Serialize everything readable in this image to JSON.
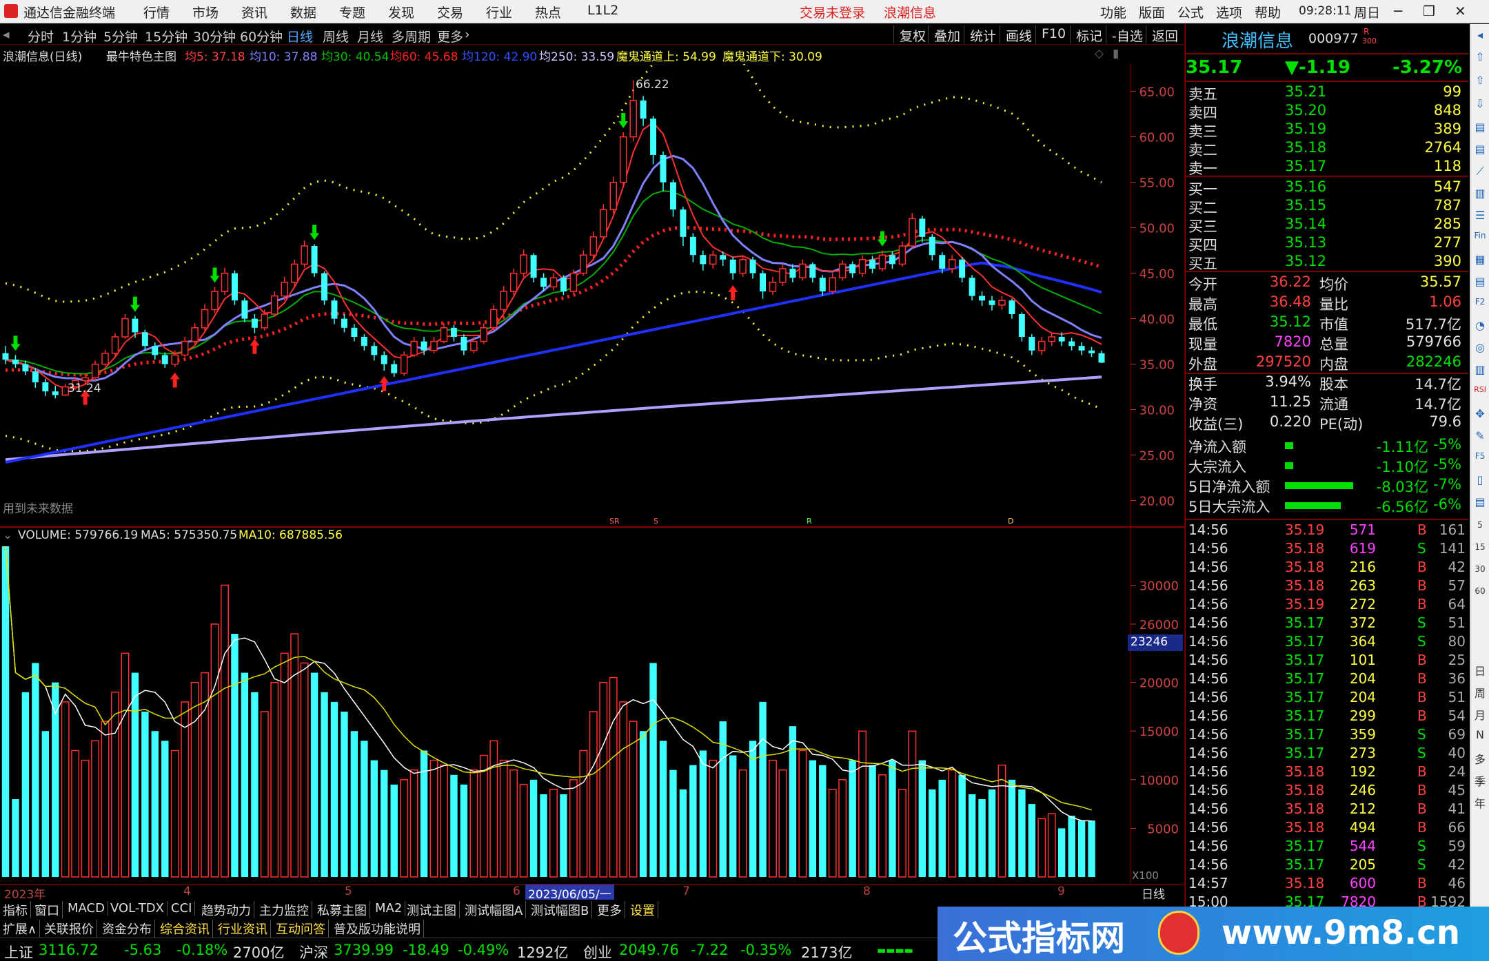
{
  "app": {
    "title": "通达信金融终端",
    "menu": [
      "行情",
      "市场",
      "资讯",
      "数据",
      "专题",
      "发现",
      "交易",
      "行业",
      "热点",
      "L1L2"
    ],
    "login_status": "交易未登录",
    "stock_title": "浪潮信息",
    "right_menu": [
      "功能",
      "版面",
      "公式",
      "选项",
      "帮助"
    ],
    "clock": "09:28:11",
    "weekday": "周日"
  },
  "periods": [
    "分时",
    "1分钟",
    "5分钟",
    "15分钟",
    "30分钟",
    "60分钟",
    "日线",
    "周线",
    "月线",
    "多周期",
    "更多"
  ],
  "active_period": "日线",
  "tools": [
    "复权",
    "叠加",
    "统计",
    "画线",
    "F10",
    "标记",
    "-自选",
    "返回"
  ],
  "legend": {
    "name": "浪潮信息(日线)",
    "formula": "最牛特色主图",
    "ma5": "均5: 37.18",
    "ma10": "均10: 37.88",
    "ma30": "均30: 40.54",
    "ma60": "均60: 45.68",
    "ma120": "均120: 42.90",
    "ma250": "均250: 33.59",
    "up": "魔鬼通道上: 54.99",
    "down": "魔鬼通道下: 30.09"
  },
  "price_axis": [
    "65.00",
    "60.00",
    "55.00",
    "50.00",
    "45.00",
    "40.00",
    "35.00",
    "30.00",
    "25.00",
    "20.00"
  ],
  "annotations": {
    "high": "66.22",
    "low": "31.24",
    "future": "用到未来数据"
  },
  "markers": [
    "SR",
    "S",
    "R",
    "D"
  ],
  "volume_legend": {
    "vol": "VOLUME: 579766.19",
    "ma5": "MA5: 575350.75",
    "ma10": "MA10: 687885.56"
  },
  "vol_axis": [
    "30000",
    "26000",
    "20000",
    "15000",
    "10000",
    "5000"
  ],
  "vol_cursor": "23246",
  "vol_unit": "X100",
  "date_axis": [
    "2023年",
    "4",
    "5",
    "6",
    "2023/06/05/一",
    "7",
    "8",
    "9"
  ],
  "date_axis_right": "日线",
  "stock": {
    "name": "浪潮信息",
    "code": "000977",
    "tag": "R",
    "tag2": "300",
    "price": "35.17",
    "change": "▼-1.19",
    "pct": "-3.27%"
  },
  "asks": [
    {
      "label": "卖五",
      "price": "35.21",
      "vol": "99"
    },
    {
      "label": "卖四",
      "price": "35.20",
      "vol": "848"
    },
    {
      "label": "卖三",
      "price": "35.19",
      "vol": "389"
    },
    {
      "label": "卖二",
      "price": "35.18",
      "vol": "2764"
    },
    {
      "label": "卖一",
      "price": "35.17",
      "vol": "118"
    }
  ],
  "bids": [
    {
      "label": "买一",
      "price": "35.16",
      "vol": "547"
    },
    {
      "label": "买二",
      "price": "35.15",
      "vol": "787"
    },
    {
      "label": "买三",
      "price": "35.14",
      "vol": "285"
    },
    {
      "label": "买四",
      "price": "35.13",
      "vol": "277"
    },
    {
      "label": "买五",
      "price": "35.12",
      "vol": "390"
    }
  ],
  "stats": [
    {
      "l1": "今开",
      "v1": "36.22",
      "l2": "均价",
      "v2": "35.57",
      "c1": "#ff4040",
      "c2": "#ffff40"
    },
    {
      "l1": "最高",
      "v1": "36.48",
      "l2": "量比",
      "v2": "1.06",
      "c1": "#ff4040",
      "c2": "#ff4040"
    },
    {
      "l1": "最低",
      "v1": "35.12",
      "l2": "市值",
      "v2": "517.7亿",
      "c1": "#00e000",
      "c2": "#e0e0e0"
    },
    {
      "l1": "现量",
      "v1": "7820",
      "l2": "总量",
      "v2": "579766",
      "c1": "#ff40ff",
      "c2": "#e0e0e0"
    },
    {
      "l1": "外盘",
      "v1": "297520",
      "l2": "内盘",
      "v2": "282246",
      "c1": "#ff4040",
      "c2": "#00e000"
    },
    {
      "l1": "换手",
      "v1": "3.94%",
      "l2": "股本",
      "v2": "14.7亿",
      "c1": "#e0e0e0",
      "c2": "#e0e0e0"
    },
    {
      "l1": "净资",
      "v1": "11.25",
      "l2": "流通",
      "v2": "14.7亿",
      "c1": "#e0e0e0",
      "c2": "#e0e0e0"
    },
    {
      "l1": "收益(三)",
      "v1": "0.220",
      "l2": "PE(动)",
      "v2": "79.6",
      "c1": "#e0e0e0",
      "c2": "#e0e0e0"
    }
  ],
  "flows": [
    {
      "label": "净流入额",
      "val": "-1.11亿",
      "pct": "-5%",
      "bar": 0.12
    },
    {
      "label": "大宗流入",
      "val": "-1.10亿",
      "pct": "-5%",
      "bar": 0.12
    },
    {
      "label": "5日净流入额",
      "val": "-8.03亿",
      "pct": "-7%",
      "bar": 0.95
    },
    {
      "label": "5日大宗流入",
      "val": "-6.56亿",
      "pct": "-6%",
      "bar": 0.78
    }
  ],
  "ticks": [
    {
      "t": "14:56",
      "p": "35.19",
      "v": "571",
      "s": "B",
      "n": "161"
    },
    {
      "t": "14:56",
      "p": "35.18",
      "v": "619",
      "s": "S",
      "n": "141"
    },
    {
      "t": "14:56",
      "p": "35.18",
      "v": "216",
      "s": "B",
      "n": "42"
    },
    {
      "t": "14:56",
      "p": "35.18",
      "v": "263",
      "s": "B",
      "n": "57"
    },
    {
      "t": "14:56",
      "p": "35.19",
      "v": "272",
      "s": "B",
      "n": "64"
    },
    {
      "t": "14:56",
      "p": "35.17",
      "v": "372",
      "s": "S",
      "n": "51"
    },
    {
      "t": "14:56",
      "p": "35.17",
      "v": "364",
      "s": "S",
      "n": "80"
    },
    {
      "t": "14:56",
      "p": "35.17",
      "v": "101",
      "s": "B",
      "n": "25"
    },
    {
      "t": "14:56",
      "p": "35.17",
      "v": "204",
      "s": "B",
      "n": "36"
    },
    {
      "t": "14:56",
      "p": "35.17",
      "v": "204",
      "s": "B",
      "n": "51"
    },
    {
      "t": "14:56",
      "p": "35.17",
      "v": "299",
      "s": "B",
      "n": "54"
    },
    {
      "t": "14:56",
      "p": "35.17",
      "v": "359",
      "s": "S",
      "n": "69"
    },
    {
      "t": "14:56",
      "p": "35.17",
      "v": "273",
      "s": "S",
      "n": "40"
    },
    {
      "t": "14:56",
      "p": "35.18",
      "v": "192",
      "s": "B",
      "n": "24"
    },
    {
      "t": "14:56",
      "p": "35.18",
      "v": "246",
      "s": "B",
      "n": "45"
    },
    {
      "t": "14:56",
      "p": "35.18",
      "v": "212",
      "s": "B",
      "n": "41"
    },
    {
      "t": "14:56",
      "p": "35.18",
      "v": "494",
      "s": "B",
      "n": "66"
    },
    {
      "t": "14:56",
      "p": "35.17",
      "v": "544",
      "s": "S",
      "n": "59"
    },
    {
      "t": "14:56",
      "p": "35.17",
      "v": "205",
      "s": "S",
      "n": "42"
    },
    {
      "t": "14:57",
      "p": "35.18",
      "v": "600",
      "s": "B",
      "n": "46"
    },
    {
      "t": "15:00",
      "p": "35.17",
      "v": "7820",
      "s": "B",
      "n": "1592"
    }
  ],
  "bottom_tabs": [
    "指标",
    "窗口",
    "MACD",
    "VOL-TDX",
    "CCI",
    "趋势动力",
    "主力监控",
    "私募主图",
    "MA2",
    "测试主图",
    "测试幅图A",
    "测试幅图B",
    "更多",
    "设置"
  ],
  "bottom_tabs2": [
    "扩展∧",
    "关联报价",
    "资金分布",
    "综合资讯",
    "行业资讯",
    "互动问答",
    "普及版功能说明"
  ],
  "status": {
    "sh_name": "上证",
    "sh_val": "3116.72",
    "sh_chg": "-5.63",
    "sh_pct": "-0.18%",
    "sh_amt": "2700亿",
    "hs_name": "沪深",
    "hs_val": "3739.99",
    "hs_chg": "-18.49",
    "hs_pct": "-0.49%",
    "hs_amt": "1292亿",
    "cy_name": "创业",
    "cy_val": "2049.76",
    "cy_chg": "-7.22",
    "cy_pct": "-0.35%",
    "cy_amt": "2173亿"
  },
  "banner": {
    "text": "公式指标网",
    "url": "www.9m8.cn"
  },
  "sidebar_labels": [
    "日",
    "周",
    "月",
    "N",
    "多",
    "季",
    "年",
    "5",
    "15",
    "30",
    "60"
  ],
  "chart_data": {
    "type": "candlestick",
    "ylim": [
      18,
      68
    ],
    "candles": [
      [
        36.2,
        35.5,
        37,
        35
      ],
      [
        35.5,
        35,
        36,
        34.6
      ],
      [
        35,
        34.2,
        35.4,
        33.8
      ],
      [
        34.2,
        33,
        34.6,
        32.4
      ],
      [
        33,
        32,
        33.4,
        31.5
      ],
      [
        32,
        31.6,
        32.6,
        31.24
      ],
      [
        31.6,
        32.5,
        32.8,
        31.5
      ],
      [
        32.5,
        33.2,
        33.6,
        32.2
      ],
      [
        33.2,
        33.5,
        34,
        32.8
      ],
      [
        33.5,
        35,
        35.4,
        33.2
      ],
      [
        35,
        36.2,
        36.6,
        34.8
      ],
      [
        36.2,
        38,
        38.4,
        35.9
      ],
      [
        38,
        40,
        40.5,
        37.8
      ],
      [
        40,
        38.5,
        40.3,
        37.9
      ],
      [
        38.5,
        37,
        38.8,
        36.5
      ],
      [
        37,
        36,
        37.4,
        35.5
      ],
      [
        36,
        35,
        36.3,
        34.6
      ],
      [
        35,
        36,
        36.5,
        34.7
      ],
      [
        36,
        37.5,
        38,
        35.8
      ],
      [
        37.5,
        39,
        39.5,
        37.2
      ],
      [
        39,
        41,
        41.6,
        38.7
      ],
      [
        41,
        43,
        43.5,
        40.6
      ],
      [
        43,
        45,
        45.6,
        42.6
      ],
      [
        45,
        42,
        45.3,
        41.5
      ],
      [
        42,
        40,
        42.3,
        39.6
      ],
      [
        40,
        39,
        40.5,
        38.4
      ],
      [
        39,
        40.5,
        41,
        38.7
      ],
      [
        40.5,
        42.5,
        43,
        40.2
      ],
      [
        42.5,
        44,
        44.6,
        42
      ],
      [
        44,
        46,
        46.5,
        43.6
      ],
      [
        46,
        48,
        48.6,
        45.6
      ],
      [
        48,
        45,
        48.2,
        44.6
      ],
      [
        45,
        42,
        45.2,
        41.5
      ],
      [
        42,
        40,
        42.3,
        39.4
      ],
      [
        40,
        39,
        40.5,
        38.5
      ],
      [
        39,
        38,
        39.4,
        37.5
      ],
      [
        38,
        37,
        38.3,
        36.5
      ],
      [
        37,
        36,
        37.4,
        35.4
      ],
      [
        36,
        35,
        36.4,
        34.3
      ],
      [
        35,
        34,
        35.4,
        33.6
      ],
      [
        34,
        36,
        36.4,
        33.7
      ],
      [
        36,
        37.5,
        38,
        35.8
      ],
      [
        37.5,
        36.5,
        38,
        36
      ],
      [
        36.5,
        37.5,
        38,
        36.2
      ],
      [
        37.5,
        39,
        39.5,
        37.3
      ],
      [
        39,
        38,
        39.3,
        37.5
      ],
      [
        38,
        36.5,
        38.3,
        36
      ],
      [
        36.5,
        37.5,
        38,
        36.2
      ],
      [
        37.5,
        39,
        39.5,
        37.2
      ],
      [
        39,
        41,
        41.5,
        38.7
      ],
      [
        41,
        43,
        43.6,
        40.7
      ],
      [
        43,
        45,
        45.5,
        42.6
      ],
      [
        45,
        47,
        47.6,
        44.6
      ],
      [
        47,
        44.5,
        47.2,
        44
      ],
      [
        44.5,
        43.5,
        45,
        43
      ],
      [
        43.5,
        44.5,
        45,
        43.1
      ],
      [
        44.5,
        43,
        44.8,
        42.6
      ],
      [
        43,
        45,
        45.4,
        42.8
      ],
      [
        45,
        47,
        47.5,
        44.7
      ],
      [
        47,
        49,
        49.6,
        46.6
      ],
      [
        49,
        52,
        52.6,
        48.7
      ],
      [
        52,
        55,
        55.6,
        51.6
      ],
      [
        55,
        60,
        60.5,
        54.6
      ],
      [
        60,
        64,
        66.22,
        59.5
      ],
      [
        64,
        62,
        64.5,
        61.2
      ],
      [
        62,
        58,
        62.3,
        57
      ],
      [
        58,
        55,
        58.4,
        54
      ],
      [
        55,
        52,
        55.3,
        51.2
      ],
      [
        52,
        49,
        52.3,
        48
      ],
      [
        49,
        47,
        49.4,
        46.2
      ],
      [
        47,
        46,
        47.5,
        45.3
      ],
      [
        46,
        47,
        47.5,
        45.5
      ],
      [
        47,
        46.5,
        47.4,
        45.8
      ],
      [
        46.5,
        45,
        46.8,
        44.3
      ],
      [
        45,
        46.5,
        47,
        44.6
      ],
      [
        46.5,
        45,
        46.8,
        44.4
      ],
      [
        45,
        43,
        45.3,
        42.2
      ],
      [
        43,
        44,
        44.6,
        42.6
      ],
      [
        44,
        45.5,
        46,
        43.6
      ],
      [
        45.5,
        44.5,
        46,
        44
      ],
      [
        44.5,
        46,
        46.5,
        44.2
      ],
      [
        46,
        44.5,
        46.2,
        44
      ],
      [
        44.5,
        43,
        44.8,
        42.5
      ],
      [
        43,
        44.5,
        45,
        42.7
      ],
      [
        44.5,
        46,
        46.4,
        44.2
      ],
      [
        46,
        45,
        46.3,
        44.5
      ],
      [
        45,
        46.5,
        47,
        44.6
      ],
      [
        46.5,
        45.5,
        46.9,
        45
      ],
      [
        45.5,
        47,
        47.5,
        45.2
      ],
      [
        47,
        46,
        47.4,
        45.5
      ],
      [
        46,
        48,
        48.5,
        45.7
      ],
      [
        48,
        51,
        51.6,
        47.7
      ],
      [
        51,
        49,
        51.3,
        48.4
      ],
      [
        49,
        47,
        49.3,
        46.4
      ],
      [
        47,
        45.5,
        47.3,
        45
      ],
      [
        45.5,
        46.5,
        47,
        45
      ],
      [
        46.5,
        44.5,
        46.8,
        44
      ],
      [
        44.5,
        42.5,
        44.8,
        42
      ],
      [
        42.5,
        42,
        43,
        41.4
      ],
      [
        42,
        41.5,
        42.5,
        40.9
      ],
      [
        41.5,
        42,
        42.5,
        41
      ],
      [
        42,
        40.5,
        42.2,
        40
      ],
      [
        40.5,
        38,
        40.7,
        37.5
      ],
      [
        38,
        36.5,
        38.3,
        36
      ],
      [
        36.5,
        37.5,
        38,
        36
      ],
      [
        37.5,
        38,
        38.4,
        37
      ],
      [
        38,
        37.5,
        38.5,
        37
      ],
      [
        37.5,
        37,
        37.9,
        36.5
      ],
      [
        37,
        36.5,
        37.4,
        36
      ],
      [
        36.5,
        36.2,
        36.9,
        35.8
      ],
      [
        36.2,
        35.17,
        36.48,
        35.12
      ]
    ],
    "ma_series": [
      {
        "name": "均5",
        "value": 37.18,
        "color": "#ff4040"
      },
      {
        "name": "均10",
        "value": 37.88,
        "color": "#8080ff"
      },
      {
        "name": "均30",
        "value": 40.54,
        "color": "#00c000"
      },
      {
        "name": "均60",
        "value": 45.68,
        "color": "#ff2020"
      },
      {
        "name": "均120",
        "value": 42.9,
        "color": "#2030ff"
      },
      {
        "name": "均250",
        "value": 33.59,
        "color": "#b0a0ff"
      }
    ],
    "channel_upper_last": 54.99,
    "channel_lower_last": 30.09,
    "volume_ylim": [
      0,
      34000
    ],
    "volume": [
      34000,
      8000,
      19000,
      22000,
      15000,
      20000,
      18000,
      13000,
      12000,
      14000,
      16000,
      19000,
      23000,
      21000,
      17000,
      15000,
      14000,
      13000,
      18000,
      20000,
      21000,
      26000,
      30000,
      25000,
      21000,
      19000,
      17000,
      20000,
      23000,
      25000,
      22000,
      21000,
      19000,
      18000,
      17000,
      15000,
      14000,
      12000,
      11000,
      9500,
      10000,
      11000,
      13000,
      12000,
      11500,
      10500,
      9500,
      11000,
      12500,
      14000,
      12000,
      11000,
      9500,
      10000,
      8500,
      9000,
      8500,
      10000,
      13000,
      17000,
      20000,
      20500,
      18000,
      16000,
      15000,
      22000,
      14000,
      11000,
      9000,
      11500,
      13000,
      12000,
      16000,
      12500,
      11000,
      14000,
      18000,
      12000,
      11000,
      15500,
      13000,
      12000,
      11500,
      9000,
      10000,
      12000,
      15000,
      11500,
      10500,
      12000,
      9000,
      15000,
      12000,
      9000,
      10000,
      11000,
      10500,
      8500,
      8000,
      9000,
      11500,
      10000,
      9000,
      7500,
      6000,
      6500,
      5000,
      6300,
      5800,
      5800
    ],
    "volume_ma5_last": 5753.5,
    "volume_ma10_last": 6878.86
  }
}
